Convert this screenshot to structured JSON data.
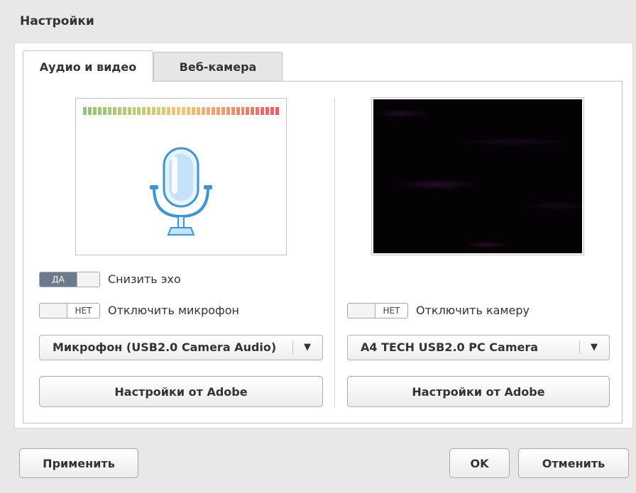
{
  "dialog": {
    "title": "Настройки"
  },
  "tabs": [
    {
      "label": "Аудио и видео",
      "active": true
    },
    {
      "label": "Веб-камера",
      "active": false
    }
  ],
  "audio": {
    "level_meter": {
      "segments": 40,
      "level": 1.0
    },
    "mic_icon": "microphone-icon",
    "echo": {
      "toggle_text": "ДА",
      "label": "Снизить эхо",
      "on": true
    },
    "mute": {
      "toggle_text": "НЕТ",
      "label": "Отключить микрофон",
      "on": false
    },
    "device": {
      "value": "Микрофон (USB2.0 Camera Audio)"
    },
    "adobe_button": "Настройки от Adobe"
  },
  "video": {
    "mute": {
      "toggle_text": "НЕТ",
      "label": "Отключить камеру",
      "on": false
    },
    "device": {
      "value": "A4 TECH USB2.0 PC Camera"
    },
    "adobe_button": "Настройки от Adobe"
  },
  "footer": {
    "apply": "Применить",
    "ok": "OK",
    "cancel": "Отменить"
  },
  "colors": {
    "toggle_on": "#6b7a8c",
    "mic_blue": "#4aa0dc"
  }
}
